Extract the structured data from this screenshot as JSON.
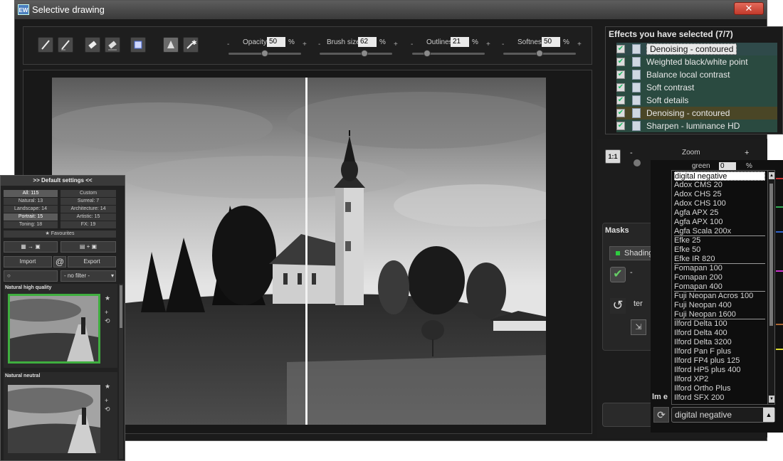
{
  "window": {
    "title": "Selective drawing",
    "close_label": "✕"
  },
  "toolbar": {
    "tools": [
      "brush-icon",
      "brush-alt-icon",
      "eraser-icon",
      "eraser-alt-icon",
      "fill-icon",
      "restore-icon",
      "magic-wand-icon"
    ],
    "sliders": [
      {
        "label": "Opacity",
        "value": "50",
        "unit": "%",
        "level": 0.5
      },
      {
        "label": "Brush size",
        "value": "62",
        "unit": "%",
        "level": 0.62
      },
      {
        "label": "Outlines",
        "value": "21",
        "unit": "%",
        "level": 0.21
      },
      {
        "label": "Softness",
        "value": "50",
        "unit": "%",
        "level": 0.5
      }
    ],
    "minus": "-",
    "plus": "+"
  },
  "effects": {
    "header": "Effects you have selected (7/7)",
    "items": [
      {
        "name": "Denoising - contoured",
        "selected": true,
        "tint": "#2f4a4a"
      },
      {
        "name": "Weighted black/white point",
        "tint": "#2a4a40"
      },
      {
        "name": "Balance local contrast",
        "tint": "#2a4a40"
      },
      {
        "name": "Soft contrast",
        "tint": "#2a4a40"
      },
      {
        "name": "Soft details",
        "tint": "#2a4a40"
      },
      {
        "name": "Denoising - contoured",
        "tint": "#4a4626"
      },
      {
        "name": "Sharpen - luminance HD",
        "tint": "#2a4a40"
      }
    ]
  },
  "zoom": {
    "label": "Zoom",
    "one_to_one": "1:1",
    "minus": "-",
    "plus": "+"
  },
  "color_field": {
    "label": "green",
    "value": "0",
    "unit": "%"
  },
  "masks": {
    "header": "Masks",
    "shading_label": "Shading",
    "filter_partial": "ter",
    "film_partial": "lm e",
    "minus": "-"
  },
  "film_list": {
    "selected": "digital negative",
    "items": [
      "digital negative",
      "Adox CMS 20",
      "Adox CHS 25",
      "Adox CHS 100",
      "Agfa APX 25",
      "Agfa APX 100",
      "Agfa Scala 200x",
      "Efke 25",
      "Efke 50",
      "Efke IR 820",
      "Fomapan 100",
      "Fomapan 200",
      "Fomapan 400",
      "Fuji Neopan Acros 100",
      "Fuji Neopan 400",
      "Fuji Neopan 1600",
      "Ilford Delta 100",
      "Ilford Delta 400",
      "Ilford Delta 3200",
      "Ilford Pan F plus",
      "Ilford FP4 plus 125",
      "Ilford HP5 plus 400",
      "Ilford XP2",
      "Ilford Ortho Plus",
      "Ilford SFX 200"
    ],
    "separators_after": [
      6,
      9,
      12,
      15
    ],
    "combo_value": "digital negative"
  },
  "presets": {
    "header": ">> Default settings <<",
    "filters": [
      {
        "label": "All: 115",
        "active": true
      },
      {
        "label": "Custom"
      },
      {
        "label": "Natural: 13"
      },
      {
        "label": "Surreal: 7"
      },
      {
        "label": "Landscape: 14"
      },
      {
        "label": "Architecture: 14"
      },
      {
        "label": "Portrait: 15",
        "active": true
      },
      {
        "label": "Artistic: 15"
      },
      {
        "label": "Toning: 18"
      },
      {
        "label": "FX: 19"
      }
    ],
    "favourites": "★ Favourites",
    "import_label": "Import",
    "export_label": "Export",
    "at_symbol": "@",
    "filter_select": "- no filter -",
    "sections": [
      {
        "title": "Natural high quality"
      },
      {
        "title": "Natural neutral"
      }
    ]
  },
  "colors": {
    "accent_green": "#3fae3f",
    "list_swatches": [
      "#cc3333",
      "#33aa55",
      "#3366cc",
      "#cc33cc",
      "#dddd33",
      "#aa6633"
    ]
  }
}
